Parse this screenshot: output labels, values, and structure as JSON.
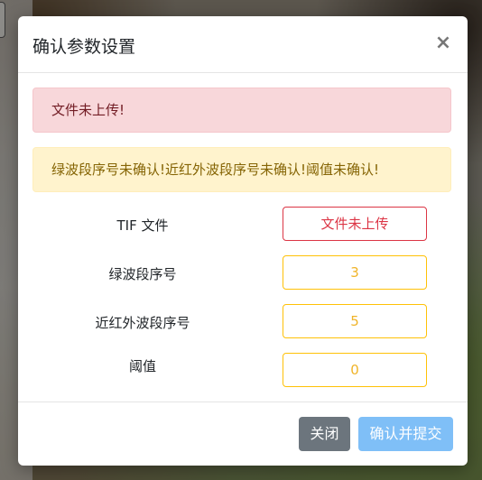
{
  "modal": {
    "title": "确认参数设置",
    "close_symbol": "×"
  },
  "alerts": {
    "danger": "文件未上传!",
    "warning": "绿波段序号未确认!近红外波段序号未确认!阈值未确认!"
  },
  "fields": [
    {
      "label": "TIF 文件",
      "value": "文件未上传",
      "status": "danger"
    },
    {
      "label": "绿波段序号",
      "value": "3",
      "status": "warning"
    },
    {
      "label": "近红外波段序号",
      "value": "5",
      "status": "warning"
    },
    {
      "label": "阈值",
      "value": "0",
      "status": "warning"
    }
  ],
  "footer": {
    "close_label": "关闭",
    "submit_label": "确认并提交"
  },
  "colors": {
    "danger": "#dc3545",
    "warning": "#ffc107",
    "secondary": "#6c757d",
    "primary_light": "#7fbff7"
  }
}
